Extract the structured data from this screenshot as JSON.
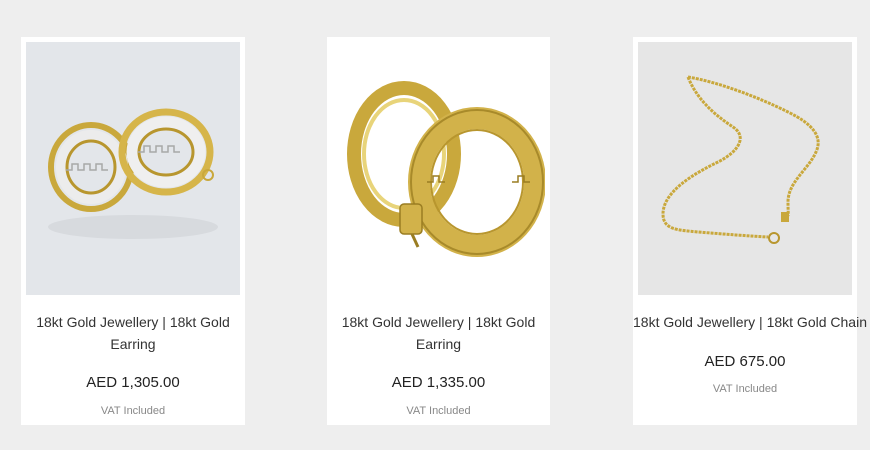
{
  "products": [
    {
      "title": "18kt Gold Jewellery | 18kt Gold Earring",
      "price": "AED 1,305.00",
      "vat": "VAT Included",
      "image_icon": "two-tone-greek-key-hoop-earrings"
    },
    {
      "title": "18kt Gold Jewellery | 18kt Gold Earring",
      "price": "AED 1,335.00",
      "vat": "VAT Included",
      "image_icon": "gold-greek-key-hoop-earrings"
    },
    {
      "title": "18kt Gold Jewellery | 18kt Gold Chain",
      "price": "AED 675.00",
      "vat": "VAT Included",
      "image_icon": "gold-chain-necklace"
    }
  ],
  "colors": {
    "page_background": "#eeeeee",
    "card_background": "#ffffff",
    "gold": "#c9a83c"
  }
}
